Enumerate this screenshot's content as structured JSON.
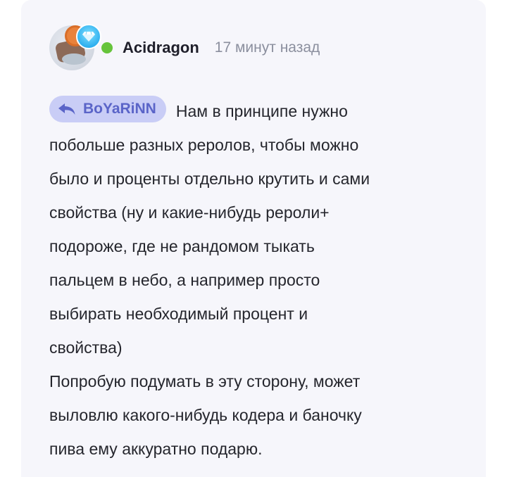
{
  "comment": {
    "author": "Acidragon",
    "timestamp": "17 минут назад",
    "online_status_color": "#66c43b",
    "avatar_icon": "avatar-image",
    "badges": [
      "orange-badge-icon",
      "diamond-gem-icon"
    ],
    "reply_to": {
      "icon": "reply-arrow-icon",
      "name": "BoYaRiNN"
    },
    "paragraph1": "Нам в принципе нужно\nпобольше разных реролов, чтобы можно\nбыло и проценты отдельно крутить и сами\nсвойства (ну и какие-нибудь рероли+\nподороже, где не рандомом тыкать\nпальцем в небо, а например просто\nвыбирать необходимый процент и\nсвойства)",
    "paragraph2": "Попробую подумать в эту сторону, может\nвыловлю какого-нибудь кодера и баночку\nпива ему аккуратно подарю."
  },
  "colors": {
    "card_background": "#f6f6fb",
    "reply_chip_background": "#c9cdf6",
    "reply_chip_text": "#5a64c8",
    "timestamp": "#8b8f9e"
  }
}
